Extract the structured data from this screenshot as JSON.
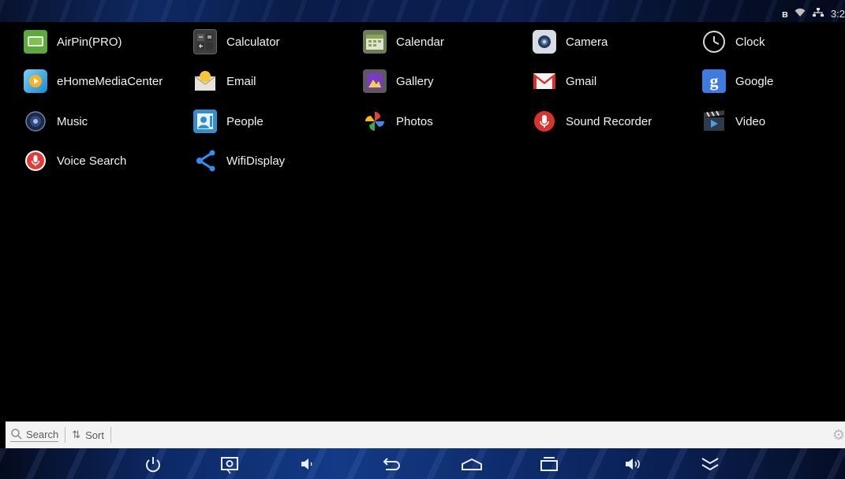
{
  "status_bar": {
    "icons": [
      "bluetooth-icon",
      "wifi-icon",
      "ethernet-icon"
    ],
    "time": "3:2"
  },
  "apps": [
    {
      "label": "AirPin(PRO)",
      "icon": "airpin-icon",
      "color": "#6ab04c"
    },
    {
      "label": "Calculator",
      "icon": "calculator-icon",
      "color": "#3b3b3b"
    },
    {
      "label": "Calendar",
      "icon": "calendar-icon",
      "color": "#7a8a5a"
    },
    {
      "label": "Camera",
      "icon": "camera-icon",
      "color": "#cfd6e0"
    },
    {
      "label": "Clock",
      "icon": "clock-icon",
      "color": "#e0e0e0"
    },
    {
      "label": "eHomeMediaCenter",
      "icon": "ehome-icon",
      "color": "#29a8e0"
    },
    {
      "label": "Email",
      "icon": "email-icon",
      "color": "#f2c232"
    },
    {
      "label": "Gallery",
      "icon": "gallery-icon",
      "color": "#8a4bd0"
    },
    {
      "label": "Gmail",
      "icon": "gmail-icon",
      "color": "#d93025"
    },
    {
      "label": "Google",
      "icon": "google-icon",
      "color": "#4a7bd6"
    },
    {
      "label": "Music",
      "icon": "music-icon",
      "color": "#3e5a9a"
    },
    {
      "label": "People",
      "icon": "people-icon",
      "color": "#3aa0d8"
    },
    {
      "label": "Photos",
      "icon": "photos-icon",
      "color": "#fbbc04"
    },
    {
      "label": "Sound Recorder",
      "icon": "sound-recorder-icon",
      "color": "#d9332b"
    },
    {
      "label": "Video",
      "icon": "video-icon",
      "color": "#3a4a5a"
    },
    {
      "label": "Voice Search",
      "icon": "voice-search-icon",
      "color": "#e53935"
    },
    {
      "label": "WifiDisplay",
      "icon": "wifidisplay-icon",
      "color": "#2f8ff2"
    }
  ],
  "search_bar": {
    "search_label": "Search",
    "sort_label": "Sort"
  },
  "nav_bar": {
    "buttons": [
      "power-icon",
      "screenshot-icon",
      "volume-down-icon",
      "back-icon",
      "home-icon",
      "recents-icon",
      "volume-up-icon",
      "collapse-icon"
    ]
  }
}
